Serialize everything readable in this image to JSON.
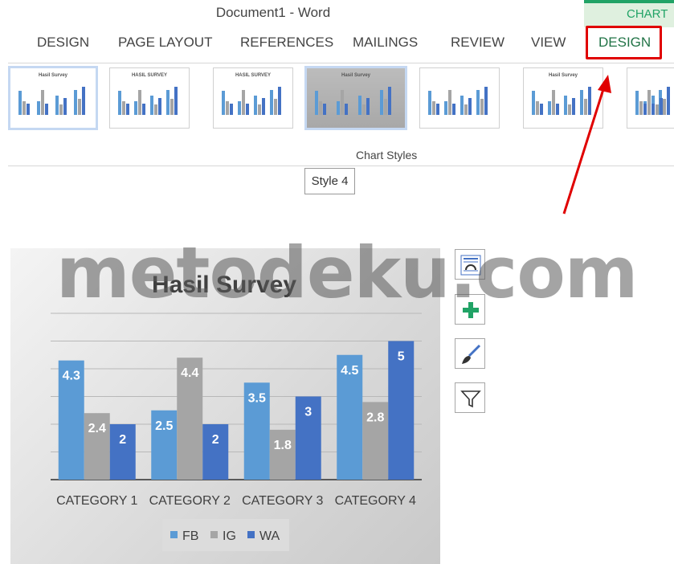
{
  "window": {
    "title": "Document1 - Word"
  },
  "ribbon": {
    "context_label": "CHART",
    "tabs": [
      {
        "label": "DESIGN"
      },
      {
        "label": "PAGE LAYOUT"
      },
      {
        "label": "REFERENCES"
      },
      {
        "label": "MAILINGS"
      },
      {
        "label": "REVIEW"
      },
      {
        "label": "VIEW"
      },
      {
        "label": "DESIGN"
      }
    ],
    "section_label": "Chart Styles",
    "tooltip": "Style 4",
    "styles": [
      {
        "title": "Hasil Survey"
      },
      {
        "title": "HASIL SURVEY"
      },
      {
        "title": "HASIL SURVEY"
      },
      {
        "title": "Hasil Survey"
      },
      {
        "title": ""
      },
      {
        "title": "Hasil Survey"
      },
      {
        "title": ""
      }
    ]
  },
  "watermark": "metodeku.com",
  "side_buttons": [
    "chart-elements-layout-icon",
    "plus-icon",
    "brush-icon",
    "filter-icon"
  ],
  "colors": {
    "FB": "#5b9bd5",
    "IG": "#a5a5a5",
    "WA": "#4472c4",
    "highlight": "#e00000",
    "accent": "#21a366"
  },
  "chart_data": {
    "type": "bar",
    "title": "Hasil Survey",
    "categories": [
      "CATEGORY 1",
      "CATEGORY 2",
      "CATEGORY 3",
      "CATEGORY 4"
    ],
    "series": [
      {
        "name": "FB",
        "values": [
          4.3,
          2.5,
          3.5,
          4.5
        ]
      },
      {
        "name": "IG",
        "values": [
          2.4,
          4.4,
          1.8,
          2.8
        ]
      },
      {
        "name": "WA",
        "values": [
          2,
          2,
          3,
          5
        ]
      }
    ],
    "ylim": [
      0,
      6
    ],
    "grid": true,
    "legend": "bottom",
    "data_labels": true
  }
}
